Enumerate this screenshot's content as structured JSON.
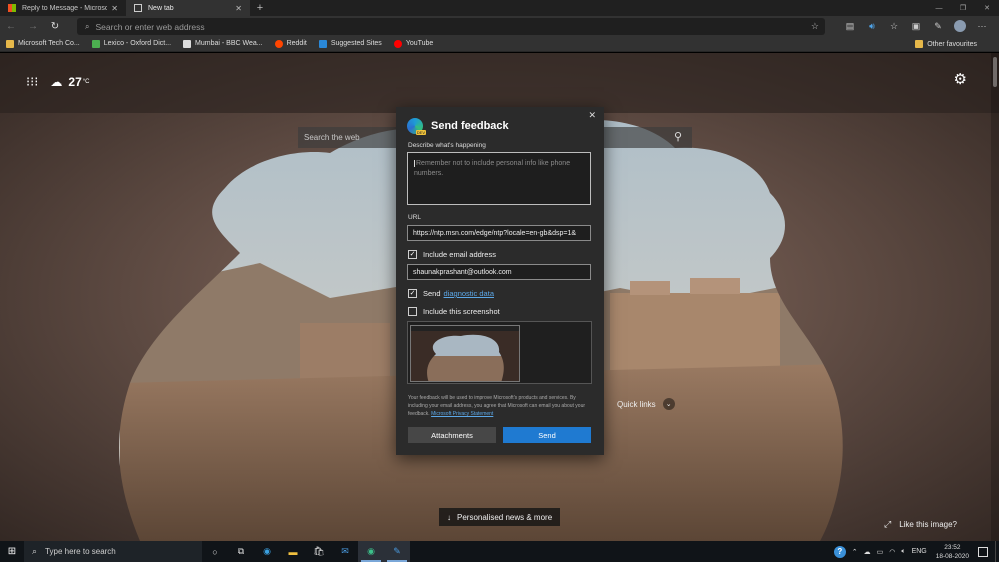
{
  "browser": {
    "tabs": [
      {
        "title": "Reply to Message - Microsoft Tech",
        "close": "✕",
        "active": false
      },
      {
        "title": "New tab",
        "close": "✕",
        "active": true
      }
    ],
    "new_tab_label": "+",
    "address_placeholder": "Search or enter web address",
    "favorites": [
      {
        "label": "Microsoft Tech Co...",
        "icon": "folder-icon",
        "color": "#e6b84a"
      },
      {
        "label": "Lexico - Oxford Dict...",
        "icon": "lexico-icon",
        "color": "#4caf50"
      },
      {
        "label": "Mumbai - BBC Wea...",
        "icon": "bbc-icon",
        "color": "#dddddd"
      },
      {
        "label": "Reddit",
        "icon": "reddit-icon",
        "color": "#ff4500"
      },
      {
        "label": "Suggested Sites",
        "icon": "bing-icon",
        "color": "#2a88d8"
      },
      {
        "label": "YouTube",
        "icon": "youtube-icon",
        "color": "#ff0000"
      }
    ],
    "other_favourites": "Other favourites"
  },
  "newtab": {
    "temperature": "27",
    "temp_unit": "°C",
    "search_placeholder": "Search the web",
    "quick_links": "Quick links",
    "news_button": "Personalised news & more",
    "like_image": "Like this image?"
  },
  "feedback": {
    "title": "Send feedback",
    "describe_label": "Describe what's happening",
    "describe_placeholder": "Remember not to include personal info like phone numbers.",
    "url_label": "URL",
    "url_value": "https://ntp.msn.com/edge/ntp?locale=en-gb&dsp=1&",
    "include_email_label": "Include email address",
    "include_email_checked": true,
    "email_value": "shaunakprashant@outlook.com",
    "send_label": "Send",
    "diagnostic_link": "diagnostic data",
    "send_diag_checked": true,
    "include_screenshot_label": "Include this screenshot",
    "include_screenshot_checked": false,
    "disclaimer_text": "Your feedback will be used to improve Microsoft's products and services. By including your email address, you agree that Microsoft can email you about your feedback.",
    "privacy_link": "Microsoft Privacy Statement",
    "attachments_button": "Attachments",
    "send_button": "Send"
  },
  "taskbar": {
    "search_placeholder": "Type here to search",
    "language": "ENG",
    "time": "23:52",
    "date": "18-08-2020"
  },
  "colors": {
    "accent_blue": "#1f7ad1",
    "link_blue": "#5ca8e8",
    "dialog_bg": "#2b2b2b"
  }
}
